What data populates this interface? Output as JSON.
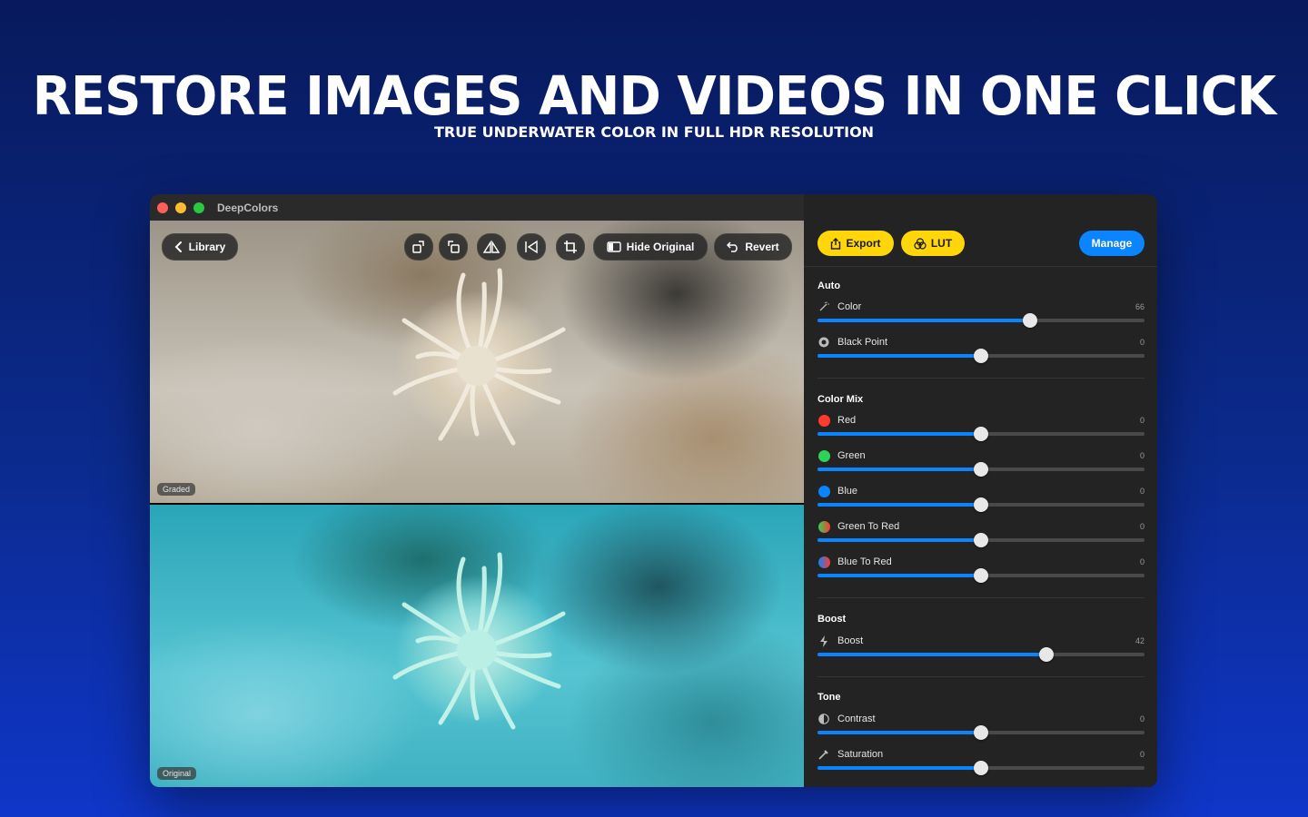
{
  "hero": {
    "headline": "RESTORE IMAGES AND VIDEOS IN ONE CLICK",
    "subheadline": "TRUE UNDERWATER COLOR IN FULL HDR RESOLUTION"
  },
  "window": {
    "title": "DeepColors",
    "traffic_colors": {
      "close": "#ff5f57",
      "minimize": "#febc2e",
      "zoom": "#28c840"
    }
  },
  "viewer": {
    "library_label": "Library",
    "hide_original_label": "Hide Original",
    "revert_label": "Revert",
    "graded_label": "Graded",
    "original_label": "Original",
    "tool_icons": [
      "rotate-right-icon",
      "rotate-left-icon",
      "flip-vertical-icon",
      "flip-horizontal-icon",
      "crop-icon"
    ]
  },
  "panel": {
    "export_label": "Export",
    "lut_label": "LUT",
    "manage_label": "Manage",
    "accent": "#0a84ff",
    "highlight": "#ffd60a",
    "sections": {
      "auto": {
        "title": "Auto",
        "color": {
          "label": "Color",
          "value": "66",
          "fraction": 0.65
        },
        "black_point": {
          "label": "Black Point",
          "value": "0",
          "fraction": 0.5
        }
      },
      "color_mix": {
        "title": "Color Mix",
        "red": {
          "label": "Red",
          "value": "0",
          "fraction": 0.5,
          "swatch": "#ff3b30"
        },
        "green": {
          "label": "Green",
          "value": "0",
          "fraction": 0.5,
          "swatch": "#30d158"
        },
        "blue": {
          "label": "Blue",
          "value": "0",
          "fraction": 0.5,
          "swatch": "#0a84ff"
        },
        "green_to_red": {
          "label": "Green To Red",
          "value": "0",
          "fraction": 0.5
        },
        "blue_to_red": {
          "label": "Blue To Red",
          "value": "0",
          "fraction": 0.5
        }
      },
      "boost": {
        "title": "Boost",
        "boost": {
          "label": "Boost",
          "value": "42",
          "fraction": 0.7
        }
      },
      "tone": {
        "title": "Tone",
        "contrast": {
          "label": "Contrast",
          "value": "0",
          "fraction": 0.5
        },
        "saturation": {
          "label": "Saturation",
          "value": "0",
          "fraction": 0.5
        }
      }
    }
  }
}
